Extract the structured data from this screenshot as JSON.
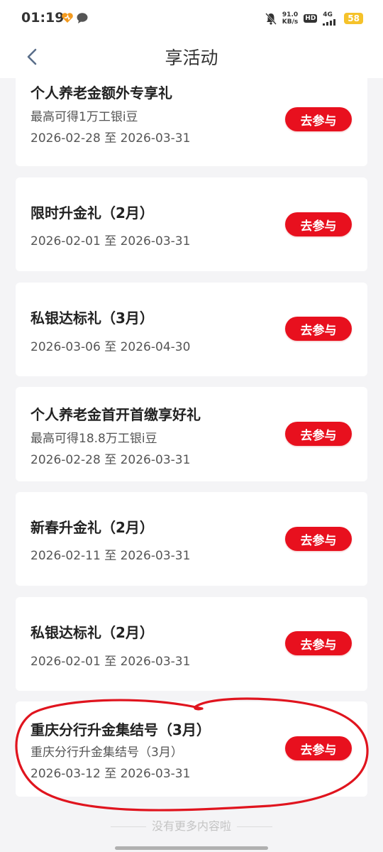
{
  "status_bar": {
    "time": "01:19",
    "net_speed_value": "91.0",
    "net_speed_unit": "KB/s",
    "hd": "HD",
    "network": "4G",
    "battery": "58"
  },
  "header": {
    "title": "享活动"
  },
  "activities": [
    {
      "title": "个人养老金额外专享礼",
      "subtitle": "最高可得1万工银i豆",
      "date": "2026-02-28 至 2026-03-31",
      "button": "去参与"
    },
    {
      "title": "限时升金礼（2月）",
      "subtitle": "",
      "date": "2026-02-01 至 2026-03-31",
      "button": "去参与"
    },
    {
      "title": "私银达标礼（3月）",
      "subtitle": "",
      "date": "2026-03-06 至 2026-04-30",
      "button": "去参与"
    },
    {
      "title": "个人养老金首开首缴享好礼",
      "subtitle": "最高可得18.8万工银i豆",
      "date": "2026-02-28 至 2026-03-31",
      "button": "去参与"
    },
    {
      "title": "新春升金礼（2月）",
      "subtitle": "",
      "date": "2026-02-11 至 2026-03-31",
      "button": "去参与"
    },
    {
      "title": "私银达标礼（2月）",
      "subtitle": "",
      "date": "2026-02-01 至 2026-03-31",
      "button": "去参与"
    },
    {
      "title": "重庆分行升金集结号（3月）",
      "subtitle": "重庆分行升金集结号（3月）",
      "date": "2026-03-12 至 2026-03-31",
      "button": "去参与"
    }
  ],
  "footer": {
    "text": "没有更多内容啦"
  },
  "colors": {
    "accent": "#e8101e",
    "annotation": "#e0141e",
    "background": "#f4f4f6"
  }
}
